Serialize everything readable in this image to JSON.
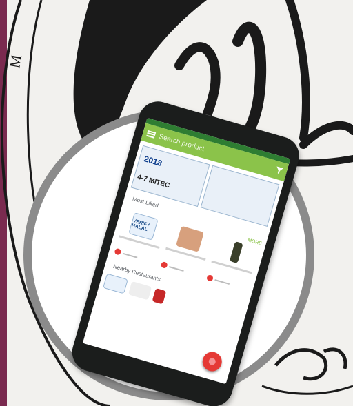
{
  "app": {
    "search_placeholder": "Search product"
  },
  "banner_event": {
    "title": "2018",
    "dates": "4-7",
    "venue": "MITEC"
  },
  "sections": {
    "most_liked": "Most Liked",
    "nearby_restaurants": "Nearby Restaurants",
    "more": "MORE"
  },
  "products": [
    {
      "badge": "VERIFY HALAL"
    },
    {
      "badge": ""
    },
    {
      "badge": ""
    }
  ],
  "colors": {
    "appbar": "#8bc34a",
    "statusbar": "#2e7d32",
    "fab": "#e53935",
    "circle": "#8b8b8b",
    "background_calligraphy": "#1a1a1a",
    "left_border": "#7a2a4f"
  },
  "icons": {
    "menu": "menu-icon",
    "filter": "filter-icon",
    "heart": "heart-icon",
    "fab": "fab-icon"
  }
}
